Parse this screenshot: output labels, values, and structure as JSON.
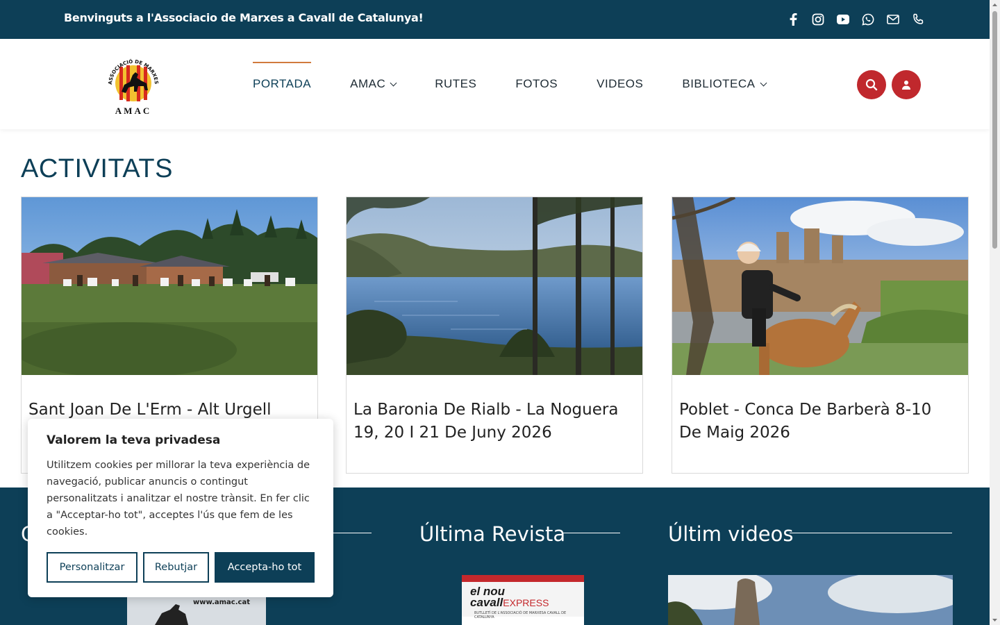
{
  "topbar": {
    "message": "Benvinguts a l'Associacio de Marxes a Cavall de Catalunya!",
    "social_icons": [
      "facebook-icon",
      "instagram-icon",
      "youtube-icon",
      "whatsapp-icon",
      "mail-icon",
      "phone-icon"
    ]
  },
  "logo": {
    "arc_text": "ASSOCIACIÓ DE MARXES A CAVALL DE CATALUNYA",
    "text": "AMAC"
  },
  "nav": {
    "items": [
      {
        "label": "PORTADA",
        "active": true
      },
      {
        "label": "AMAC",
        "has_dropdown": true
      },
      {
        "label": "RUTES"
      },
      {
        "label": "FOTOS"
      },
      {
        "label": "VIDEOS"
      },
      {
        "label": "BIBLIOTECA",
        "has_dropdown": true
      }
    ]
  },
  "main": {
    "section_title": "ACTIVITATS",
    "cards": [
      {
        "title": "Sant Joan De L'Erm - Alt Urgell"
      },
      {
        "title": "La Baronia De Rialb - La Noguera 19, 20 I 21 De Juny 2026"
      },
      {
        "title": "Poblet - Conca De Barberà 8-10 De Maig 2026"
      }
    ]
  },
  "footer": {
    "col1_heading_fragment": "C",
    "col2_heading": "Última Revista",
    "col3_heading": "Últim videos",
    "magazine_url_text": "www.amac.cat",
    "magazine_cover_title_1": "el nou",
    "magazine_cover_title_2": "cavall",
    "magazine_cover_title_3": "EXPRESS",
    "magazine_cover_subtitle": "BUTLLETÍ DE L'ASSOCIACIÓ DE MARXESA CAVALL DE CATALUNYA"
  },
  "cookie": {
    "title": "Valorem la teva privadesa",
    "text": "Utilitzem cookies per millorar la teva experiència de navegació, publicar anuncis o contingut personalitzats i analitzar el nostre trànsit. En fer clic a \"Acceptar-ho tot\", acceptes l'ús que fem de les cookies.",
    "btn_customize": "Personalitzar",
    "btn_reject": "Rebutjar",
    "btn_accept": "Accepta-ho tot"
  },
  "colors": {
    "brand": "#0d3f57",
    "accent_red": "#c0282d",
    "active_underline": "#d17a3c"
  }
}
